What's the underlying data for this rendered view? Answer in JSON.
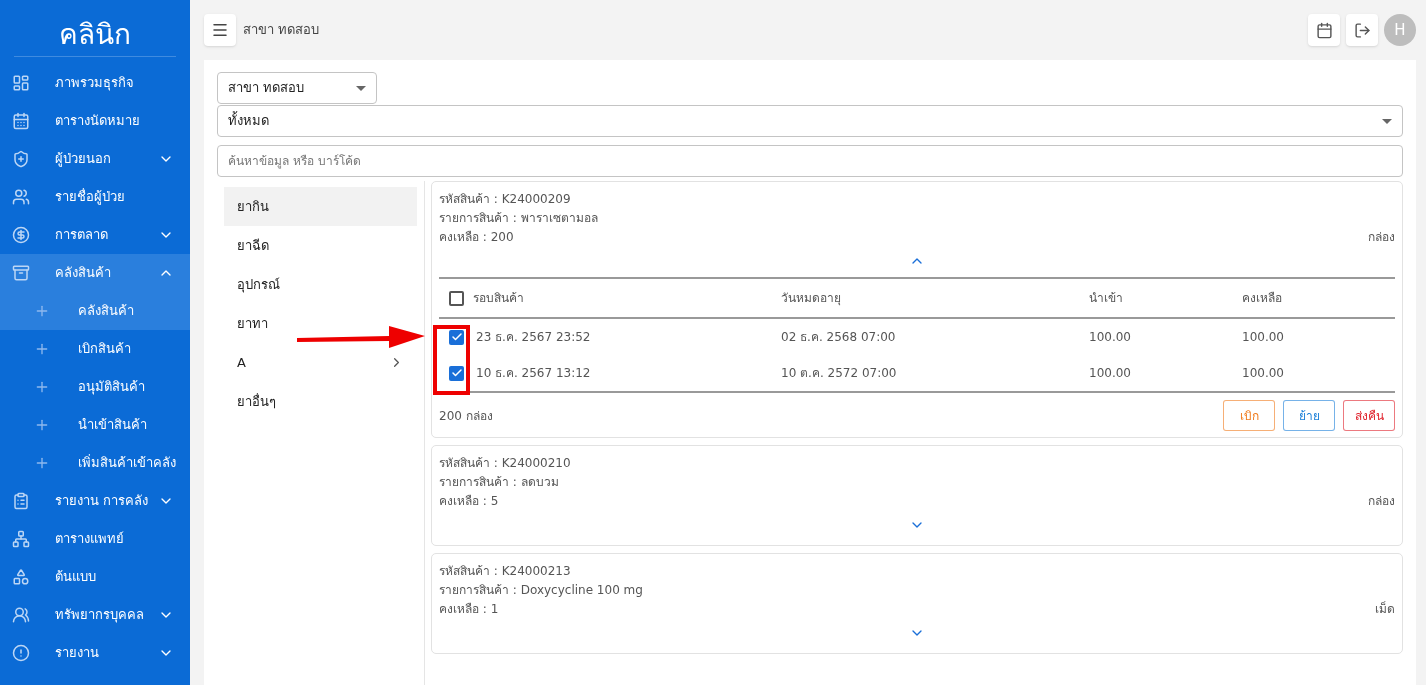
{
  "sidebar": {
    "brand": "คลินิก",
    "items": [
      {
        "label": "ภาพรวมธุรกิจ",
        "kind": "link"
      },
      {
        "label": "ตารางนัดหมาย",
        "kind": "link"
      },
      {
        "label": "ผู้ป่วยนอก",
        "kind": "group",
        "expanded": false
      },
      {
        "label": "รายชื่อผู้ป่วย",
        "kind": "link"
      },
      {
        "label": "การตลาด",
        "kind": "group",
        "expanded": false
      },
      {
        "label": "คลังสินค้า",
        "kind": "group",
        "expanded": true,
        "children": [
          {
            "label": "คลังสินค้า",
            "selected": true
          },
          {
            "label": "เบิกสินค้า",
            "selected": false
          },
          {
            "label": "อนุมัติสินค้า",
            "selected": false
          },
          {
            "label": "นำเข้าสินค้า",
            "selected": false
          },
          {
            "label": "เพิ่มสินค้าเข้าคลัง",
            "selected": false
          }
        ]
      },
      {
        "label": "รายงาน การคลัง",
        "kind": "group",
        "expanded": false
      },
      {
        "label": "ตารางแพทย์",
        "kind": "link"
      },
      {
        "label": "ต้นแบบ",
        "kind": "link"
      },
      {
        "label": "ทรัพยากรบุคคล",
        "kind": "group",
        "expanded": false
      },
      {
        "label": "รายงาน",
        "kind": "group",
        "expanded": false
      }
    ]
  },
  "header": {
    "branch": "สาขา ทดสอบ",
    "avatar": "H"
  },
  "filters": {
    "branch": "สาขา ทดสอบ",
    "category": "ทั้งหมด",
    "search": {
      "placeholder": "ค้นหาข้อมูล หรือ บาร์โค้ด"
    }
  },
  "categories": [
    {
      "label": "ยากิน",
      "selected": true,
      "kind": "item"
    },
    {
      "label": "ยาฉีด",
      "selected": false,
      "kind": "item"
    },
    {
      "label": "อุปกรณ์",
      "selected": false,
      "kind": "item"
    },
    {
      "label": "ยาทา",
      "selected": false,
      "kind": "item"
    },
    {
      "label": "A",
      "selected": false,
      "kind": "submenu"
    },
    {
      "label": "ยาอื่นๆ",
      "selected": false,
      "kind": "item"
    }
  ],
  "products": [
    {
      "code": "รหัสสินค้า : K24000209",
      "name": "รายการสินค้า : พาราเซตามอล",
      "remaining": "คงเหลือ : 200",
      "unit": "กล่อง",
      "expanded": true,
      "table": {
        "all_checked": false,
        "columns": [
          "รอบสินค้า",
          "วันหมดอายุ",
          "นำเข้า",
          "คงเหลือ"
        ],
        "rows": [
          {
            "checked": true,
            "cells": [
              "23 ธ.ค. 2567 23:52",
              "02 ธ.ค. 2568 07:00",
              "100.00",
              "100.00"
            ]
          },
          {
            "checked": true,
            "cells": [
              "10 ธ.ค. 2567 13:12",
              "10 ต.ค. 2572 07:00",
              "100.00",
              "100.00"
            ]
          }
        ]
      },
      "total": "200 กล่อง",
      "buttons": [
        {
          "label": "เบิก",
          "color": "#f07a1a"
        },
        {
          "label": "ย้าย",
          "color": "#1a7fd8"
        },
        {
          "label": "ส่งคืน",
          "color": "#e0202a"
        }
      ]
    },
    {
      "code": "รหัสสินค้า : K24000210",
      "name": "รายการสินค้า : ลดบวม",
      "remaining": "คงเหลือ : 5",
      "unit": "กล่อง",
      "expanded": false
    },
    {
      "code": "รหัสสินค้า : K24000213",
      "name": "รายการสินค้า : Doxycycline 100 mg",
      "remaining": "คงเหลือ : 1",
      "unit": "เม็ด",
      "expanded": false
    }
  ]
}
